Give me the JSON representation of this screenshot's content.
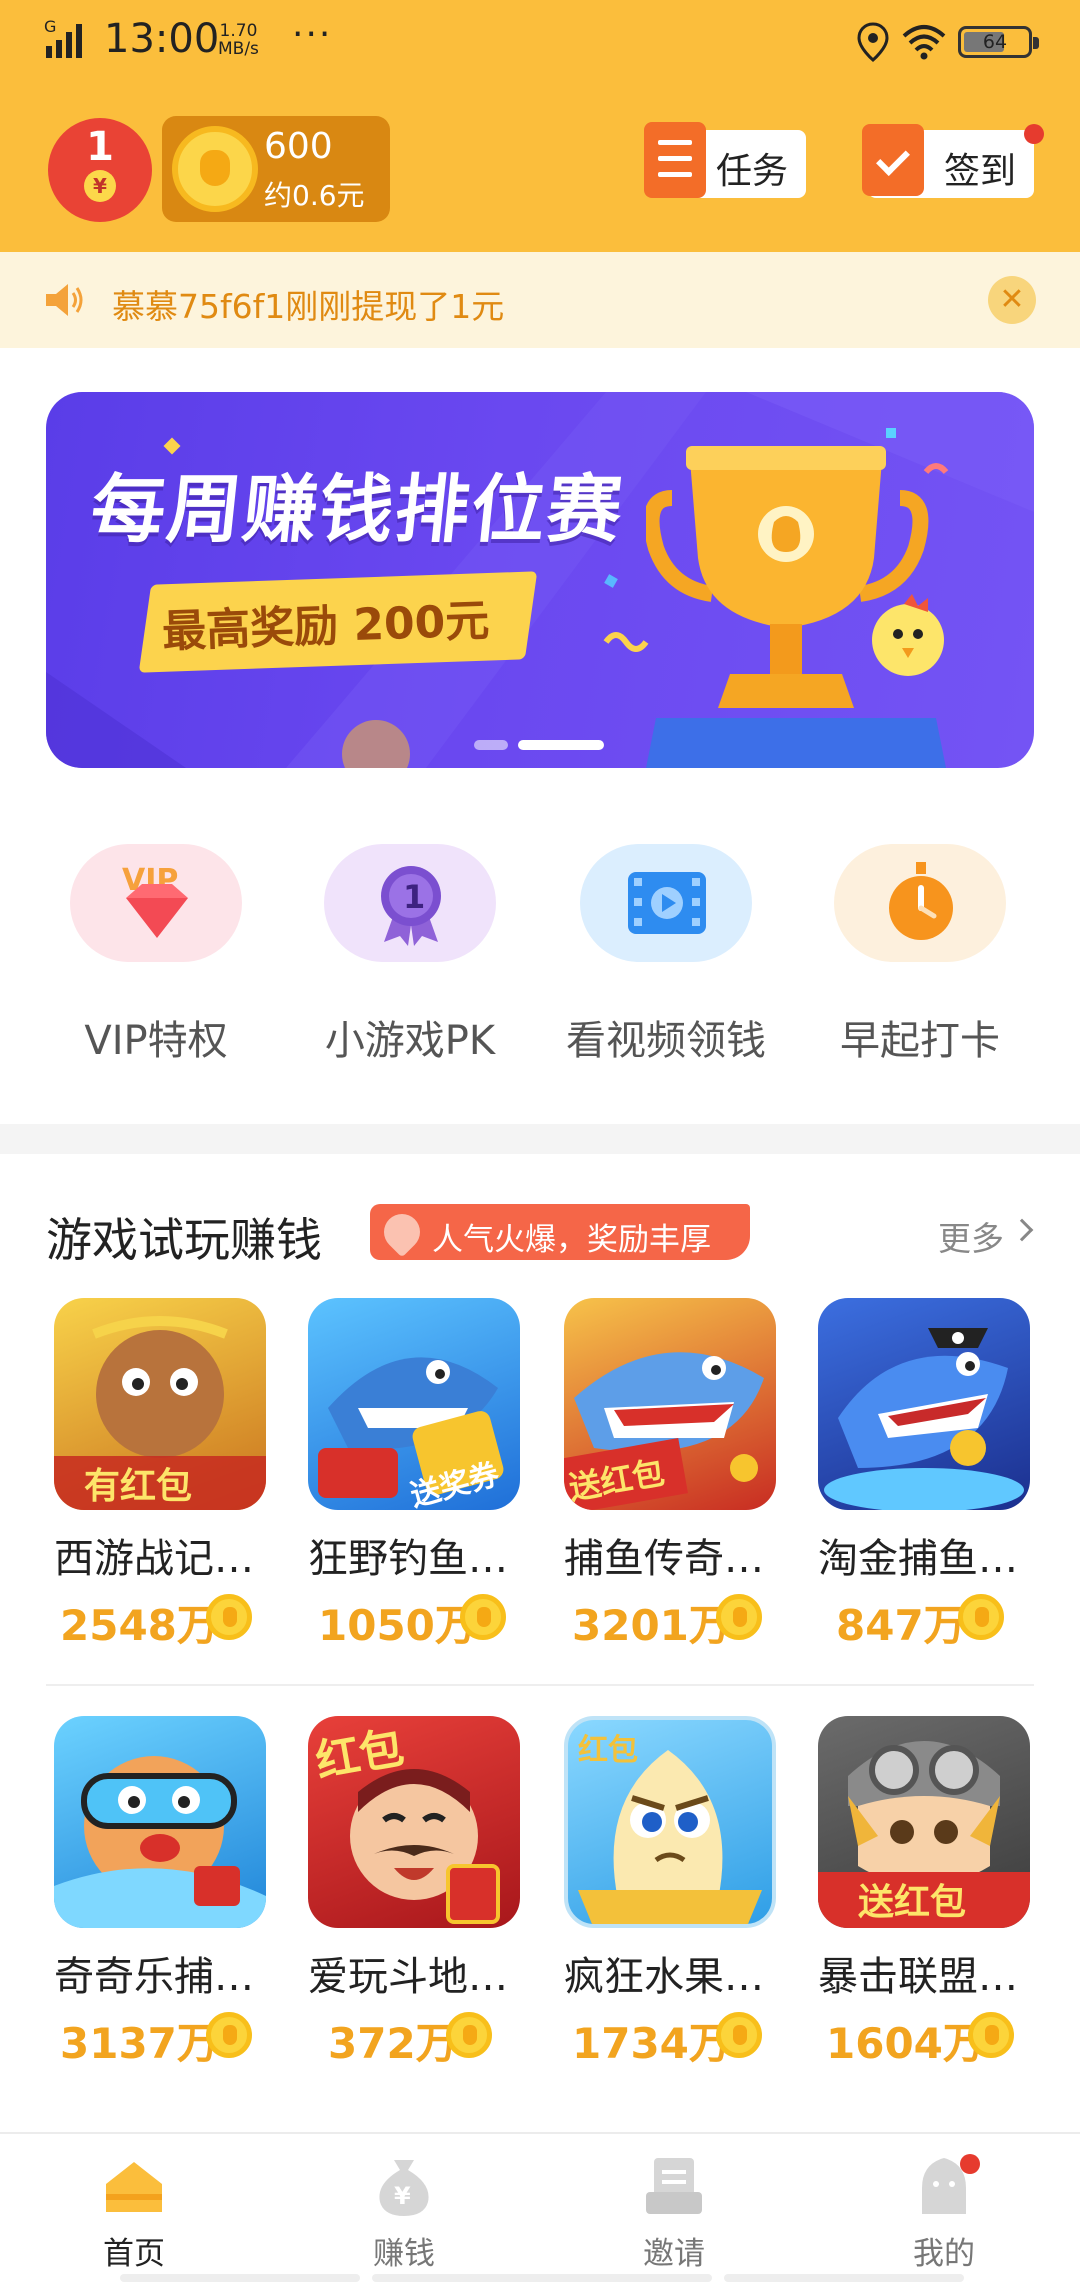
{
  "status": {
    "time": "13:00",
    "speed_value": "1.70",
    "speed_unit": "MB/s",
    "dots": "···",
    "battery": "64"
  },
  "header": {
    "redpacket_count": "1",
    "redpacket_symbol": "¥",
    "coins": "600",
    "coins_approx": "约0.6元",
    "task_label": "任务",
    "signin_label": "签到"
  },
  "notice": {
    "message": "慕慕75f6f1刚刚提现了1元",
    "close_symbol": "✕"
  },
  "banner": {
    "title": "每周赚钱排位赛",
    "subtitle": "最高奖励 200元",
    "active_slide": 2,
    "slide_count": 2
  },
  "features": [
    {
      "label": "VIP特权",
      "icon": "vip-gem-icon",
      "vip_text": "VIP"
    },
    {
      "label": "小游戏PK",
      "icon": "medal-icon",
      "medal_text": "1"
    },
    {
      "label": "看视频领钱",
      "icon": "video-icon"
    },
    {
      "label": "早起打卡",
      "icon": "stopwatch-icon"
    }
  ],
  "games_section": {
    "title": "游戏试玩赚钱",
    "hot_tag": "人气火爆，奖励丰厚",
    "more": "更多"
  },
  "games": [
    {
      "name": "西游战记…",
      "count": "2548万",
      "badge": "有红包",
      "color": "#e8a82c"
    },
    {
      "name": "狂野钓鱼…",
      "count": "1050万",
      "badge": "送奖券",
      "color": "#3b8be0"
    },
    {
      "name": "捕鱼传奇…",
      "count": "3201万",
      "badge": "送红包",
      "color": "#d8302a"
    },
    {
      "name": "淘金捕鱼…",
      "count": "847万",
      "badge": "",
      "color": "#2f58c8"
    },
    {
      "name": "奇奇乐捕…",
      "count": "3137万",
      "badge": "",
      "color": "#2e9fe8"
    },
    {
      "name": "爱玩斗地…",
      "count": "372万",
      "badge": "红包",
      "color": "#d8302a"
    },
    {
      "name": "疯狂水果…",
      "count": "1734万",
      "badge": "红包",
      "color": "#4bb6ee"
    },
    {
      "name": "暴击联盟…",
      "count": "1604万",
      "badge": "送红包",
      "color": "#c94a2a"
    }
  ],
  "bottom_nav": [
    {
      "label": "首页",
      "icon": "home-icon",
      "active": true
    },
    {
      "label": "赚钱",
      "icon": "money-bag-icon",
      "active": false
    },
    {
      "label": "邀请",
      "icon": "invite-icon",
      "active": false
    },
    {
      "label": "我的",
      "icon": "profile-icon",
      "active": false
    }
  ],
  "colors": {
    "header_bg": "#fbbe3c",
    "accent_orange": "#f36d28",
    "coin_text": "#f2a41f",
    "notice_text": "#e08a12",
    "banner_purple": "#6a48f0",
    "hot_tag": "#f56648"
  }
}
